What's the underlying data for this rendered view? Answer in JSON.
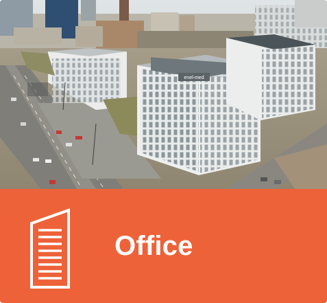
{
  "card": {
    "label": "Office",
    "icon": "office-building-icon",
    "accent_color": "#ee6239"
  },
  "photo": {
    "building_sign": "enel-med"
  }
}
